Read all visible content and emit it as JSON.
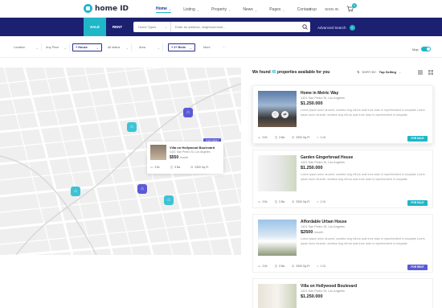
{
  "nav": {
    "logo": "home ID",
    "menu": [
      {
        "label": "Home"
      },
      {
        "label": "Listing"
      },
      {
        "label": "Property"
      },
      {
        "label": "News"
      },
      {
        "label": "Pages"
      },
      {
        "label": "Contact"
      }
    ],
    "language": "ENG",
    "sign_in": "SIGN IN",
    "cart_count": "0"
  },
  "search": {
    "tab_sale": "SALE",
    "tab_rent": "RENT",
    "home_types": "Home Types",
    "placeholder": "Enter an address, neighbourhood...",
    "advanced": "Advanced Search"
  },
  "filters": {
    "items": [
      {
        "label": "Location"
      },
      {
        "label": "Any Price"
      },
      {
        "label": "+ House"
      },
      {
        "label": "All status"
      },
      {
        "label": "Area"
      },
      {
        "label": "+ 2+ Beds"
      },
      {
        "label": "More"
      }
    ],
    "more_dots": "···",
    "map_label": "Map"
  },
  "map": {
    "popup": {
      "badge": "FOR RENT",
      "title": "Villa on Hollywood Boulevard",
      "address": "1421 San Pedro St, Los Angeles",
      "price": "$550",
      "period": "/month",
      "beds": "3 Br",
      "baths": "3 Ba",
      "area": "2300 Sq.Ft"
    }
  },
  "results": {
    "prefix": "We found",
    "count": "45",
    "suffix": "properties available for you",
    "sort_label": "SORT BY:",
    "sort_value": "Top Selling"
  },
  "listings": [
    {
      "title": "Home in Metric Way",
      "address": "1421 San Pedro St, Los Angeles",
      "price": "$1.250.000",
      "period": "",
      "desc": "Lorem ipsum dolor sit amet, sectetur cing elit uis aute irure dolor in reprehenderit in voluptate Lorem ipsum dolor sit amet, sectetur cing elit uis aute irure dolor in reprehenderit in voluptate",
      "beds": "3 Br",
      "baths": "3 Ba",
      "area": "2300 Sq.Ft",
      "garage": "1 Gr",
      "badge": "FOR SALE"
    },
    {
      "title": "Garden Gingerbread House",
      "address": "1421 San Pedro St, Los Angeles",
      "price": "$1.250.000",
      "period": "",
      "desc": "Lorem ipsum dolor sit amet, sectetur cing elit uis aute irure dolor in reprehenderit in voluptate Lorem ipsum dolor sit amet, sectetur cing elit uis aute irure dolor in reprehenderit in voluptate",
      "beds": "3 Br",
      "baths": "3 Ba",
      "area": "2300 Sq.Ft",
      "garage": "1 Gr",
      "badge": "FOR SALE"
    },
    {
      "title": "Affordable Urban House",
      "address": "1421 San Pedro St, Los Angeles",
      "price": "$2500",
      "period": "/month",
      "desc": "Lorem ipsum dolor sit amet, sectetur cing elit uis aute irure dolor in reprehenderit in voluptate Lorem ipsum dolor sit amet, sectetur cing elit uis aute irure dolor in reprehenderit in voluptate",
      "beds": "3 Br",
      "baths": "3 Ba",
      "area": "2300 Sq.Ft",
      "garage": "1 Gr",
      "badge": "FOR RENT"
    },
    {
      "title": "Villa on Hollywood Boulevard",
      "address": "1421 San Pedro St, Los Angeles",
      "price": "$1.250.000",
      "period": ""
    }
  ],
  "colors": {
    "navy": "#1c2071",
    "teal": "#1fb6c8",
    "purple": "#5a5ad6"
  }
}
